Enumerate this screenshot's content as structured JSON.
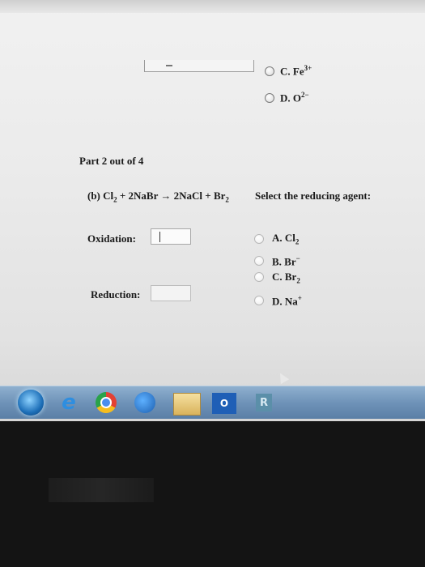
{
  "part": {
    "label": "Part 2 out of 4"
  },
  "previous_question": {
    "options": [
      {
        "letter": "C.",
        "base": "Fe",
        "sup": "3+"
      },
      {
        "letter": "D.",
        "base": "O",
        "sup": "2−"
      }
    ]
  },
  "question": {
    "prefix": "(b) Cl",
    "sub1": "2",
    "mid": " + 2NaBr → 2NaCl + Br",
    "sub2": "2",
    "prompt": "Select the reducing agent:"
  },
  "fields": {
    "oxidation_label": "Oxidation:",
    "reduction_label": "Reduction:"
  },
  "options": [
    {
      "letter": "A.",
      "base": "Cl",
      "sub": "2",
      "sup": ""
    },
    {
      "letter": "B.",
      "base": "Br",
      "sub": "",
      "sup": "−"
    },
    {
      "letter": "C.",
      "base": "Br",
      "sub": "2",
      "sup": ""
    },
    {
      "letter": "D.",
      "base": "Na",
      "sub": "",
      "sup": "+"
    }
  ],
  "taskbar": {
    "ie_glyph": "e",
    "outlook_glyph": "O",
    "r_glyph": "R"
  },
  "colors": {
    "taskbar": "#6f93b8",
    "page_bg": "#ebebeb"
  }
}
